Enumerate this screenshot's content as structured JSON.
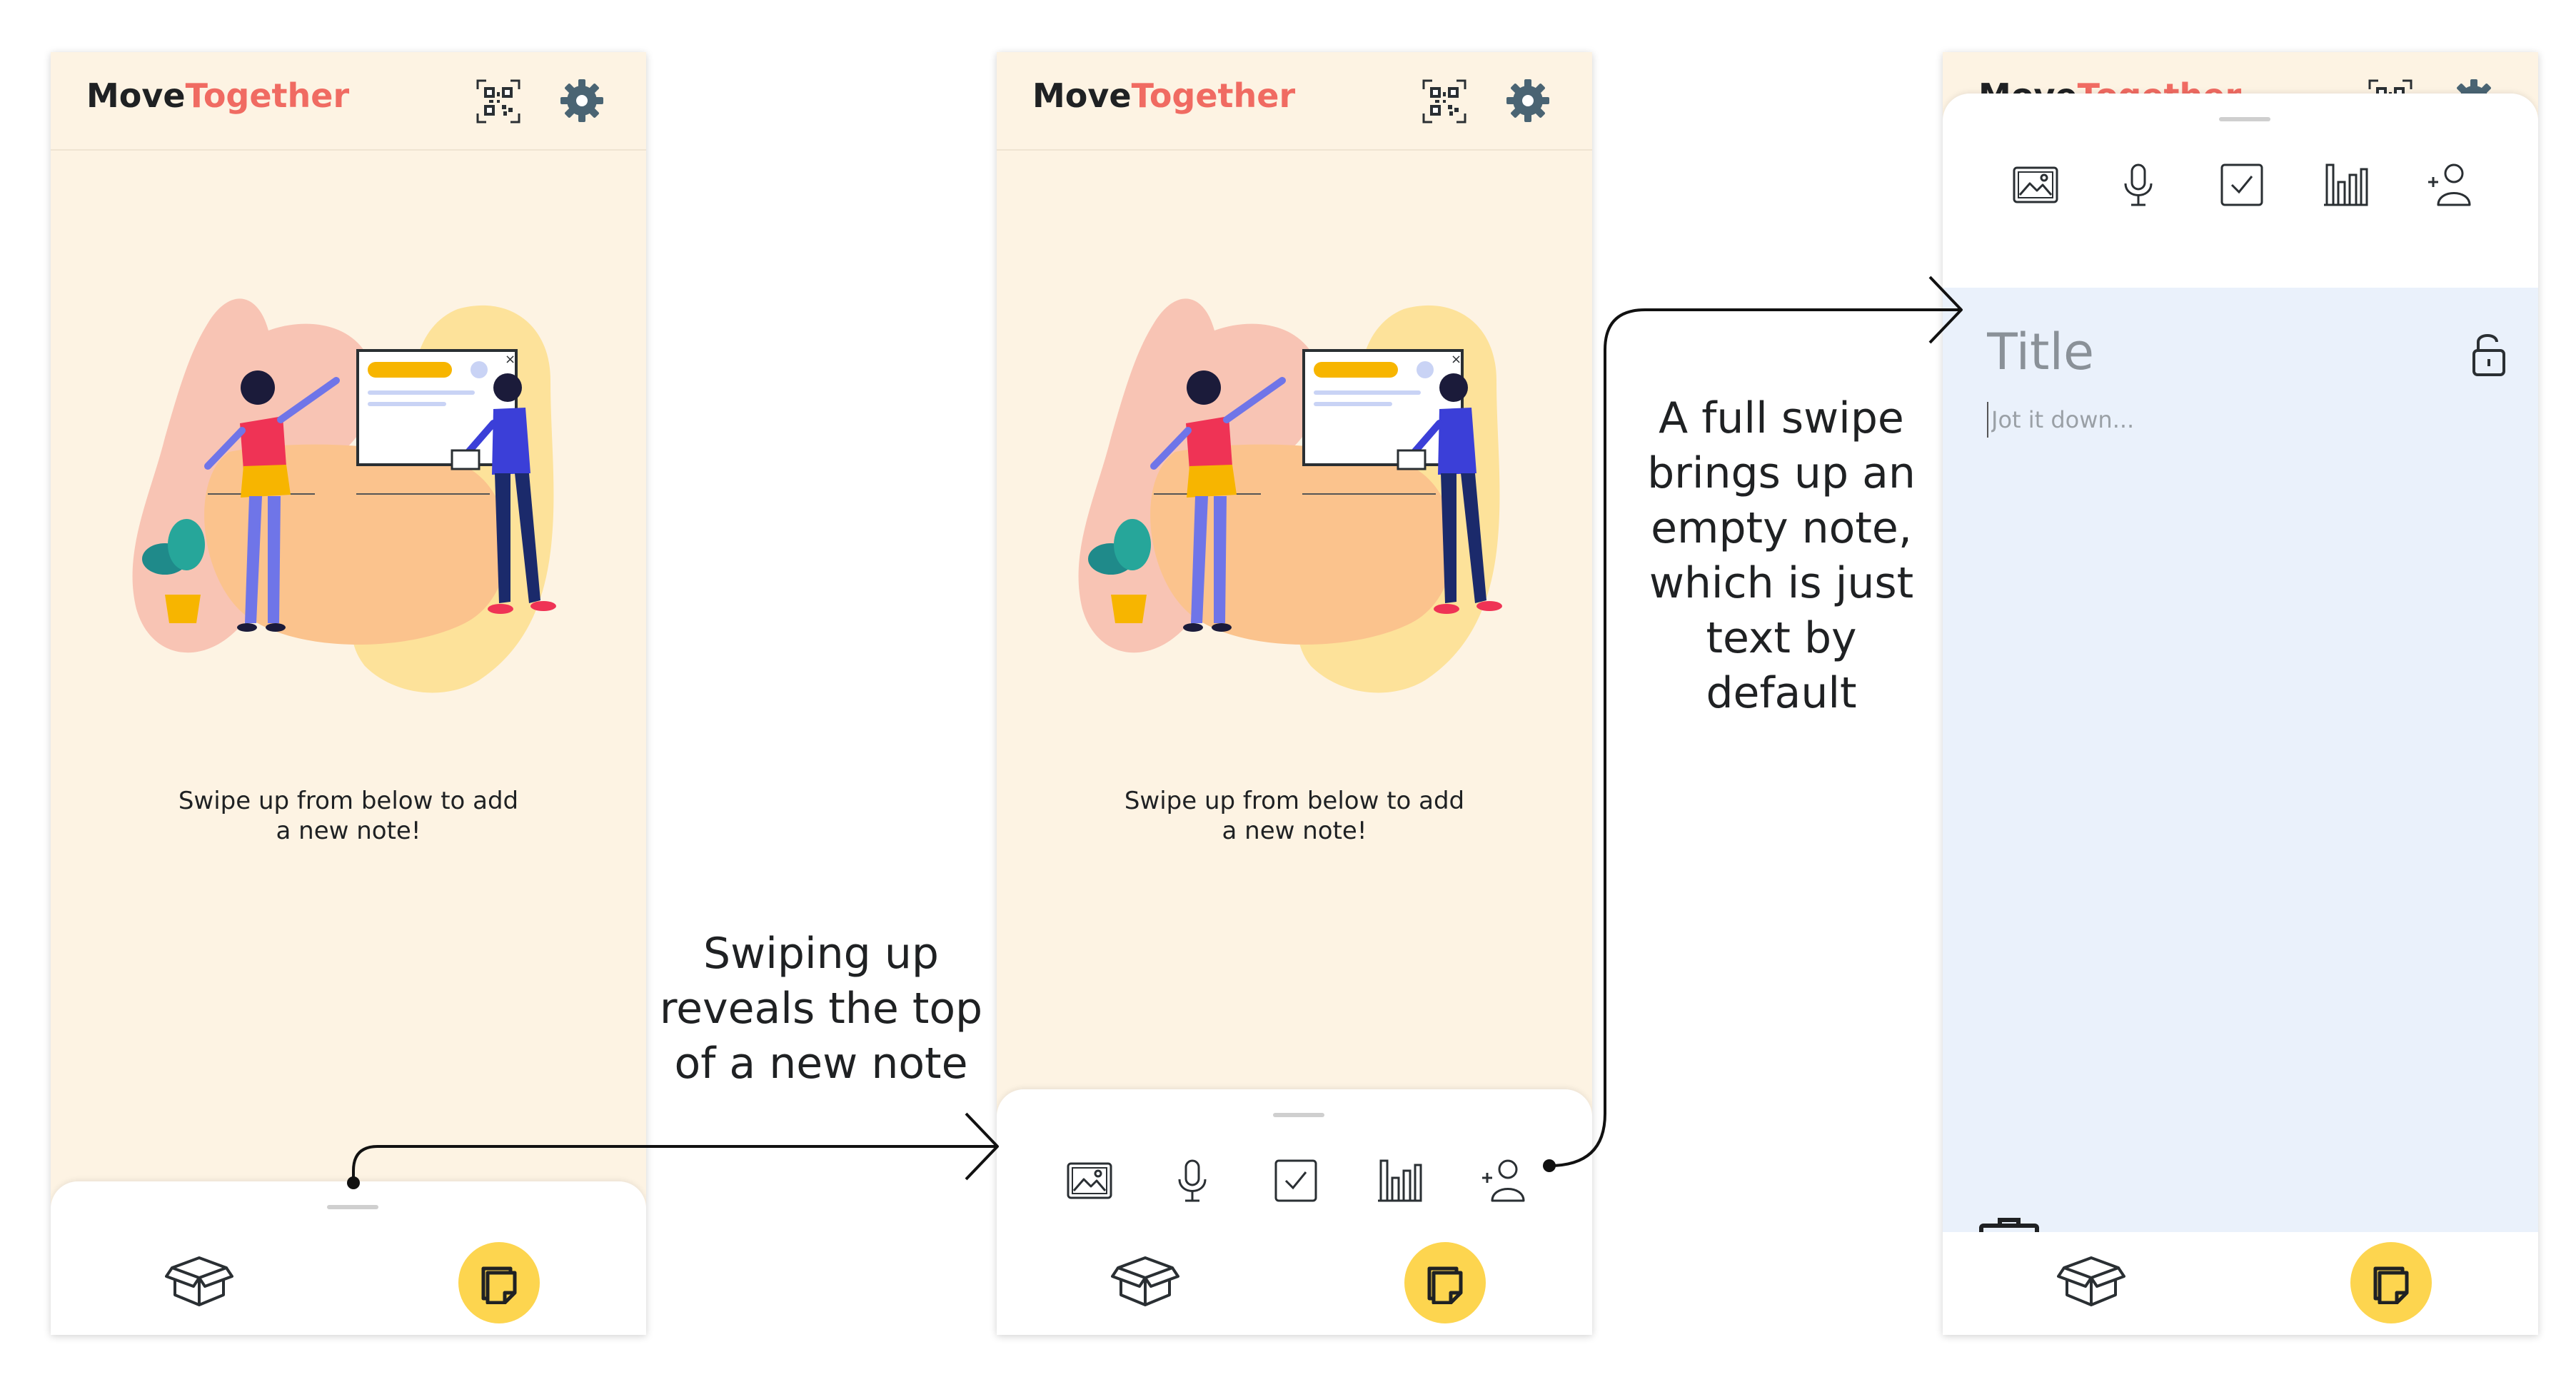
{
  "app": {
    "logo_part1": "Move",
    "logo_part2": "Together",
    "colors": {
      "logo_dark": "#1f2123",
      "logo_accent": "#f06b62",
      "background": "#fdf3e3",
      "fab": "#fdd54f",
      "note_bg": "#eaf1fb"
    }
  },
  "header_icons": [
    "qr-code-icon",
    "gear-icon"
  ],
  "empty_state": {
    "message": "Swipe up from below to add\na new note!"
  },
  "toolbar_icons": [
    "image-icon",
    "microphone-icon",
    "checkbox-icon",
    "bar-chart-icon",
    "add-person-icon"
  ],
  "bottom_nav_icons": [
    "archive-box-icon",
    "notes-icon"
  ],
  "note": {
    "title_placeholder": "Title",
    "body_placeholder": "Jot it down...",
    "icons": [
      "unlock-icon",
      "trash-icon"
    ]
  },
  "annotations": {
    "swipe_partial": "Swiping up\nreveals the top\nof a new note",
    "swipe_full": "A full swipe\nbrings up an\nempty note,\nwhich is just\ntext by default"
  }
}
